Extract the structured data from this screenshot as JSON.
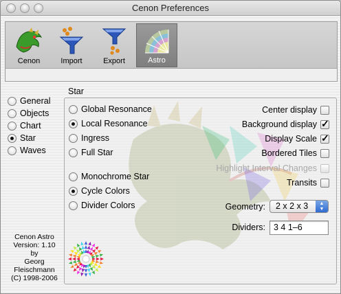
{
  "window": {
    "title": "Cenon Preferences"
  },
  "toolbar": {
    "items": [
      {
        "label": "Cenon",
        "icon": "dragon-icon"
      },
      {
        "label": "Import",
        "icon": "funnel-import-icon"
      },
      {
        "label": "Export",
        "icon": "funnel-export-icon"
      },
      {
        "label": "Astro",
        "icon": "astro-wheel-icon",
        "selected": true
      }
    ]
  },
  "sidebar": {
    "items": [
      {
        "label": "General",
        "selected": false
      },
      {
        "label": "Objects",
        "selected": false
      },
      {
        "label": "Chart",
        "selected": false
      },
      {
        "label": "Star",
        "selected": true
      },
      {
        "label": "Waves",
        "selected": false
      }
    ]
  },
  "section": {
    "title": "Star"
  },
  "star_options": {
    "group1": [
      {
        "label": "Global Resonance",
        "selected": false
      },
      {
        "label": "Local Resonance",
        "selected": true
      },
      {
        "label": "Ingress",
        "selected": false
      },
      {
        "label": "Full Star",
        "selected": false
      }
    ],
    "group2": [
      {
        "label": "Monochrome Star",
        "selected": false
      },
      {
        "label": "Cycle Colors",
        "selected": true
      },
      {
        "label": "Divider Colors",
        "selected": false
      }
    ]
  },
  "checkboxes": [
    {
      "label": "Center display",
      "checked": false,
      "enabled": true
    },
    {
      "label": "Background display",
      "checked": true,
      "enabled": true
    },
    {
      "label": "Display Scale",
      "checked": true,
      "enabled": true
    },
    {
      "label": "Bordered Tiles",
      "checked": false,
      "enabled": true
    },
    {
      "label": "Highlight Interval Changes",
      "checked": false,
      "enabled": false
    },
    {
      "label": "Transits",
      "checked": false,
      "enabled": true
    }
  ],
  "geometry": {
    "label": "Geometry:",
    "value": "2 x 2 x 3"
  },
  "dividers": {
    "label": "Dividers:",
    "value": "3 4 1–6"
  },
  "about": {
    "lines": [
      "Cenon Astro",
      "Version: 1.10",
      "by",
      "Georg",
      "Fleischmann",
      "(C) 1998-2006"
    ]
  },
  "colors": {
    "accent": "#2f6bd1",
    "selected_tab": "#8a8a8a"
  }
}
